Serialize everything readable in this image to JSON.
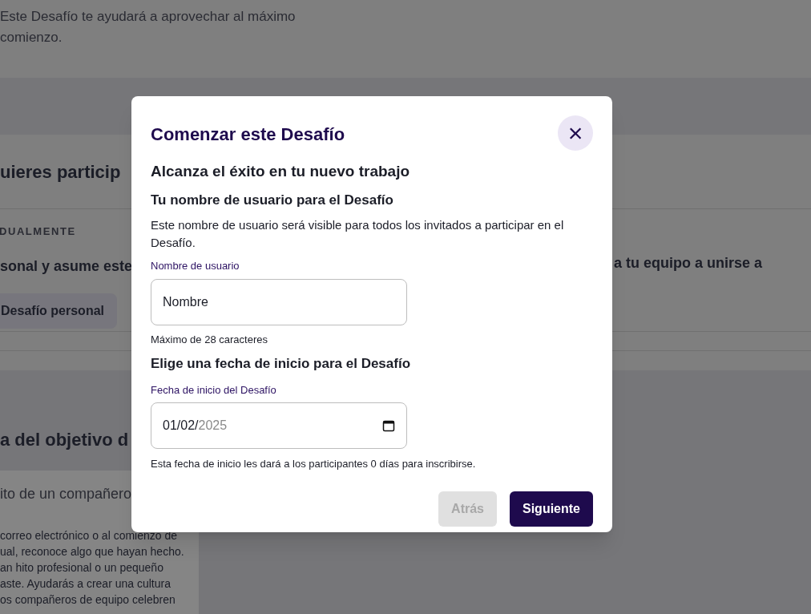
{
  "background": {
    "intro_lines": [
      "Este Desafío te ayudará a aprovechar al máximo",
      "comienzo."
    ],
    "participation_heading": "uieres particip",
    "individual_label": "DUALMENTE",
    "individual_text": "sonal y asume este",
    "team_text": "a tu equipo a unirse a",
    "personal_button": "Desafío personal",
    "goal_heading": "a del objetivo d",
    "goal_card_title": "ito de un compañero",
    "goal_card_lines": [
      "correo electrónico o al comienzo de",
      "ual, reconoce algo que hayan hecho.",
      "an hito profesional o un pequeño",
      "aste. Ayudarás a crear una cultura",
      "os compañeros de equipo celebren"
    ]
  },
  "dialog": {
    "title": "Comenzar este Desafío",
    "close": "×",
    "challenge_name": "Alcanza el éxito en tu nuevo trabajo",
    "username_heading": "Tu nombre de usuario para el Desafío",
    "username_help": "Este nombre de usuario será visible para todos los invitados a participar en el Desafío.",
    "username_field": {
      "label": "Nombre de usuario",
      "value": "Nombre",
      "hint": "Máximo de 28 caracteres"
    },
    "date_heading": "Elige una fecha de inicio para el Desafío",
    "date_field": {
      "label": "Fecha de inicio del Desafío",
      "value": "01/02/",
      "placeholder": "2025",
      "hint": "Esta fecha de inicio les dará a los participantes 0 días para inscribirse."
    },
    "buttons": [
      {
        "label": "Atrás",
        "kind": "secondary",
        "disabled": true
      },
      {
        "label": "Siguiente",
        "kind": "primary",
        "disabled": false
      }
    ]
  }
}
